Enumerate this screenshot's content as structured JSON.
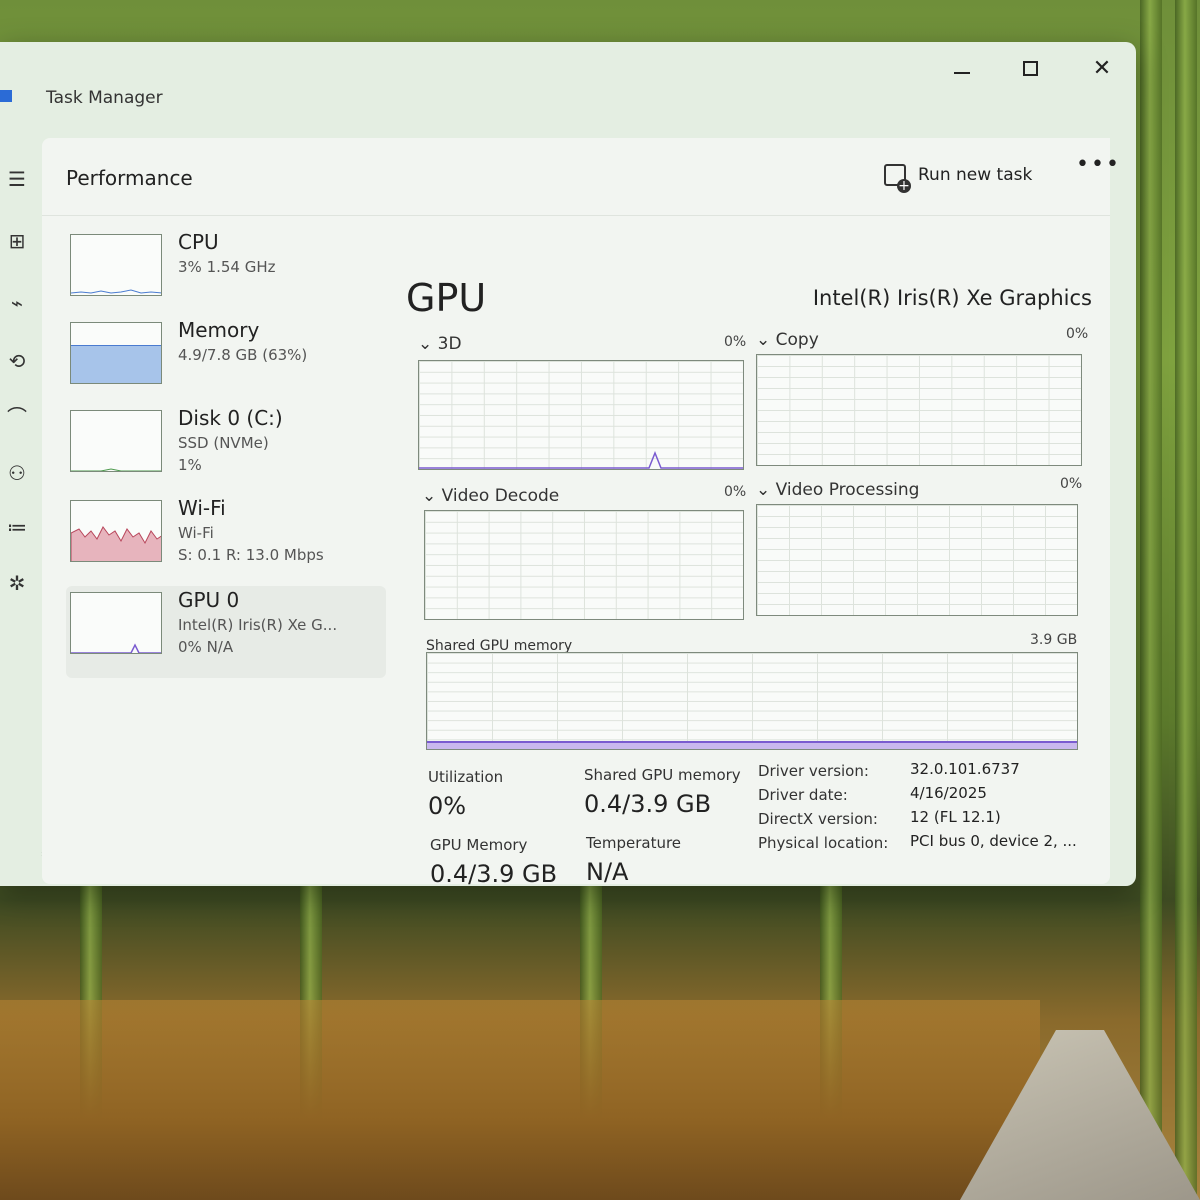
{
  "window": {
    "title": "Task Manager",
    "close_glyph": "✕"
  },
  "nav": {
    "icons": [
      "hamburger-menu-icon",
      "processes-icon",
      "performance-icon",
      "app-history-icon",
      "startup-apps-icon",
      "users-icon",
      "details-icon",
      "services-icon",
      "settings-icon"
    ]
  },
  "header": {
    "title": "Performance",
    "run_new_task": "Run new task",
    "more": "•••"
  },
  "devices": [
    {
      "name": "CPU",
      "sub": "3% 1.54 GHz",
      "sub2": ""
    },
    {
      "name": "Memory",
      "sub": "4.9/7.8 GB (63%)",
      "sub2": ""
    },
    {
      "name": "Disk 0 (C:)",
      "sub": "SSD (NVMe)",
      "sub2": "1%"
    },
    {
      "name": "Wi-Fi",
      "sub": "Wi-Fi",
      "sub2": "S: 0.1 R: 13.0 Mbps"
    },
    {
      "name": "GPU 0",
      "sub": "Intel(R) Iris(R) Xe G...",
      "sub2": "0% N/A"
    }
  ],
  "memory_fill": 0.63,
  "gpu": {
    "title": "GPU",
    "model": "Intel(R) Iris(R) Xe Graphics",
    "engines": [
      {
        "label": "3D",
        "pct": "0%"
      },
      {
        "label": "Copy",
        "pct": "0%"
      },
      {
        "label": "Video Decode",
        "pct": "0%"
      },
      {
        "label": "Video Processing",
        "pct": "0%"
      }
    ],
    "shared_label": "Shared GPU memory",
    "shared_max": "3.9 GB",
    "stats": {
      "utilization_label": "Utilization",
      "utilization": "0%",
      "shared_label": "Shared GPU memory",
      "shared": "0.4/3.9 GB",
      "gpu_mem_label": "GPU Memory",
      "gpu_mem": "0.4/3.9 GB",
      "temp_label": "Temperature",
      "temp": "N/A"
    },
    "info": [
      {
        "key": "Driver version:",
        "value": "32.0.101.6737"
      },
      {
        "key": "Driver date:",
        "value": "4/16/2025"
      },
      {
        "key": "DirectX version:",
        "value": "12 (FL 12.1)"
      },
      {
        "key": "Physical location:",
        "value": "PCI bus 0, device 2, ..."
      }
    ]
  }
}
